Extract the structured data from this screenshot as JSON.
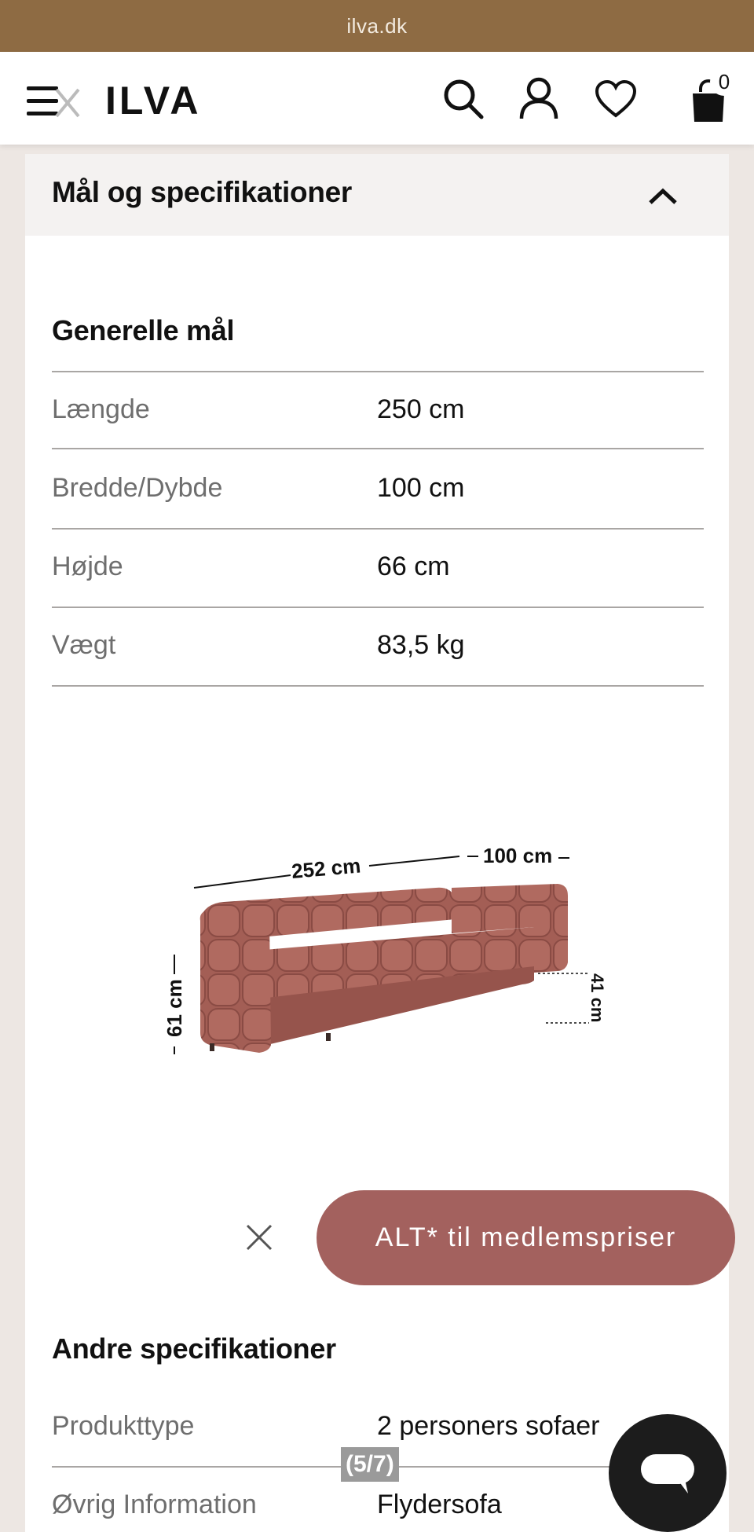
{
  "browser": {
    "url": "ilva.dk"
  },
  "header": {
    "logo": "ILVA",
    "cart_count": "0"
  },
  "accordion": {
    "title": "Mål og specifikationer"
  },
  "general": {
    "heading": "Generelle mål",
    "rows": [
      {
        "label": "Længde",
        "value": "250 cm"
      },
      {
        "label": "Bredde/Dybde",
        "value": "100 cm"
      },
      {
        "label": "Højde",
        "value": "66 cm"
      },
      {
        "label": "Vægt",
        "value": "83,5 kg"
      }
    ]
  },
  "diagram": {
    "length": "252 cm",
    "depth": "100 cm",
    "height": "61 cm",
    "seat_height": "41 cm"
  },
  "member_cta": {
    "label": "ALT* til medlemspriser"
  },
  "other": {
    "heading": "Andre specifikationer",
    "rows": [
      {
        "label": "Produkttype",
        "value": "2 personers sofaer"
      },
      {
        "label": "Øvrig Information",
        "value": "Flydersofa"
      }
    ]
  },
  "gallery": {
    "counter": "(5/7)"
  },
  "colors": {
    "brand_bar": "#8e6b43",
    "cta": "#a3615e",
    "sofa": "#a35e55"
  }
}
